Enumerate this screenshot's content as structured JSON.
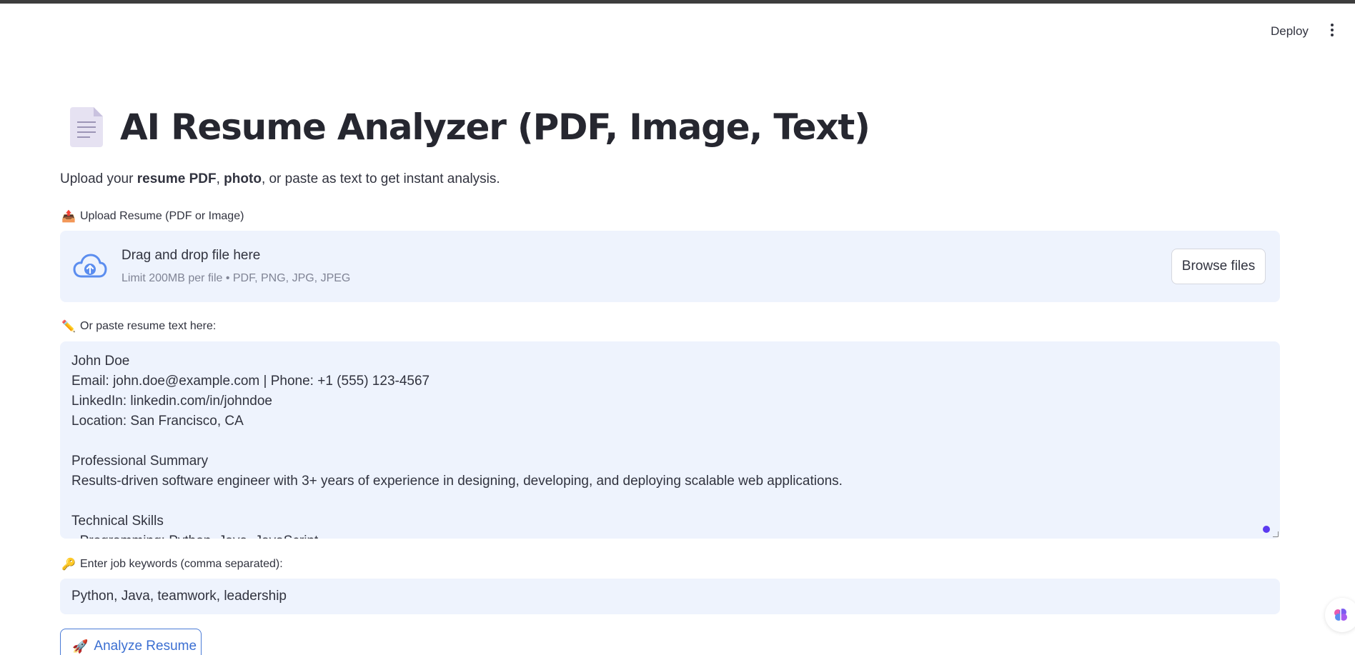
{
  "header": {
    "deploy_label": "Deploy"
  },
  "page": {
    "title": "AI Resume Analyzer (PDF, Image, Text)",
    "subtitle_pre": "Upload your ",
    "subtitle_bold1": "resume PDF",
    "subtitle_sep": ", ",
    "subtitle_bold2": "photo",
    "subtitle_post": ", or paste as text to get instant analysis."
  },
  "upload": {
    "emoji": "📤",
    "label": "Upload Resume (PDF or Image)",
    "dropzone_title": "Drag and drop file here",
    "dropzone_limit": "Limit 200MB per file • PDF, PNG, JPG, JPEG",
    "browse_label": "Browse files"
  },
  "paste": {
    "emoji": "✏️",
    "label": "Or paste resume text here:",
    "lines": [
      "John Doe",
      "Email: john.doe@example.com | Phone: +1 (555) 123-4567",
      "LinkedIn: linkedin.com/in/johndoe",
      "Location: San Francisco, CA",
      "",
      "Professional Summary",
      "Results-driven software engineer with 3+ years of experience in designing, developing, and deploying scalable web applications.",
      "",
      "Technical Skills",
      "- Programming: Python, Java, JavaScript"
    ]
  },
  "keywords": {
    "emoji": "🔑",
    "label": "Enter job keywords (comma separated):",
    "value": "Python, Java, teamwork, leadership"
  },
  "analyze": {
    "emoji": "🚀",
    "label": "Analyze Resume"
  },
  "icons": {
    "document": "document-icon",
    "cloud_upload": "cloud-upload-icon",
    "menu": "more-vertical-icon",
    "brain": "brain-icon"
  },
  "colors": {
    "accent": "#3b6fd2",
    "input_bg": "#eef3fd",
    "text": "#31333f",
    "muted": "#808495",
    "resize_handle": "#5b3af0"
  }
}
